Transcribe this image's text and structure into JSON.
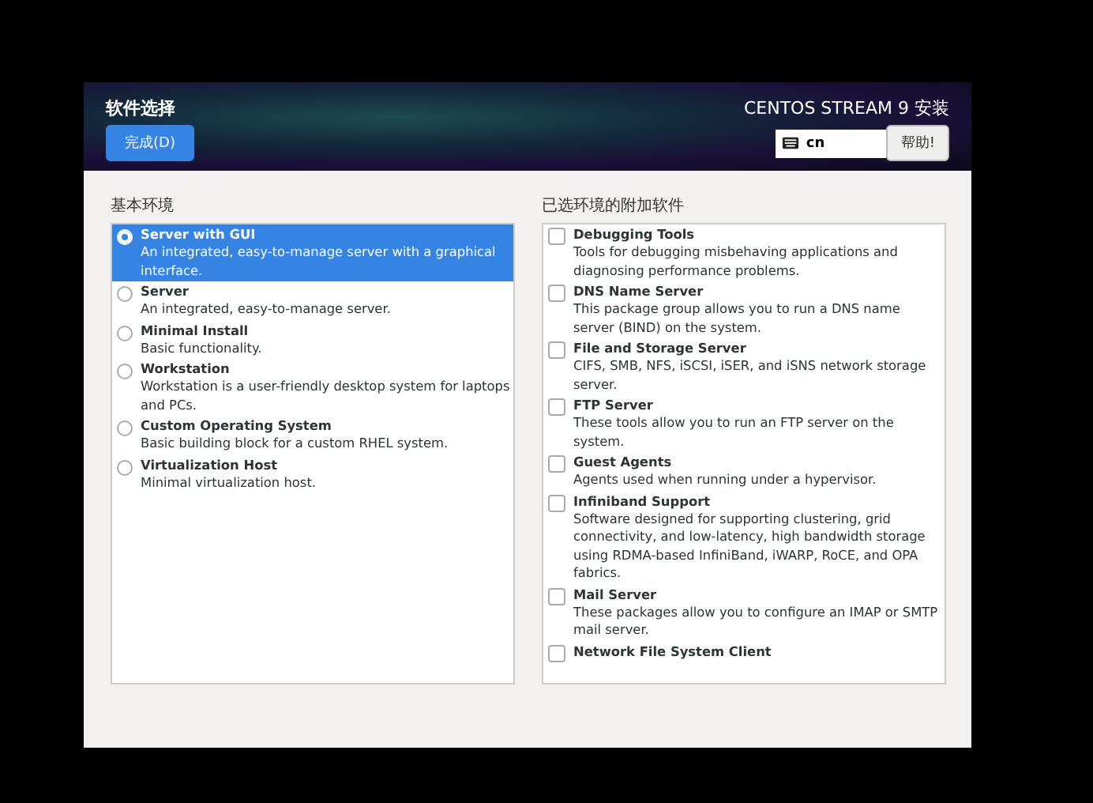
{
  "header": {
    "title": "软件选择",
    "done_button": "完成(D)",
    "product": "CENTOS STREAM 9 安装",
    "keyboard_layout": "cn",
    "help_button": "帮助!"
  },
  "environments": {
    "heading": "基本环境",
    "items": [
      {
        "name": "Server with GUI",
        "description": "An integrated, easy-to-manage server with a graphical interface.",
        "selected": true
      },
      {
        "name": "Server",
        "description": "An integrated, easy-to-manage server.",
        "selected": false
      },
      {
        "name": "Minimal Install",
        "description": "Basic functionality.",
        "selected": false
      },
      {
        "name": "Workstation",
        "description": "Workstation is a user-friendly desktop system for laptops and PCs.",
        "selected": false
      },
      {
        "name": "Custom Operating System",
        "description": "Basic building block for a custom RHEL system.",
        "selected": false
      },
      {
        "name": "Virtualization Host",
        "description": "Minimal virtualization host.",
        "selected": false
      }
    ]
  },
  "addons": {
    "heading": "已选环境的附加软件",
    "items": [
      {
        "name": "Debugging Tools",
        "description": "Tools for debugging misbehaving applications and diagnosing performance problems.",
        "checked": false
      },
      {
        "name": "DNS Name Server",
        "description": "This package group allows you to run a DNS name server (BIND) on the system.",
        "checked": false
      },
      {
        "name": "File and Storage Server",
        "description": "CIFS, SMB, NFS, iSCSI, iSER, and iSNS network storage server.",
        "checked": false
      },
      {
        "name": "FTP Server",
        "description": "These tools allow you to run an FTP server on the system.",
        "checked": false
      },
      {
        "name": "Guest Agents",
        "description": "Agents used when running under a hypervisor.",
        "checked": false
      },
      {
        "name": "Infiniband Support",
        "description": "Software designed for supporting clustering, grid connectivity, and low-latency, high bandwidth storage using RDMA-based InfiniBand, iWARP, RoCE, and OPA fabrics.",
        "checked": false
      },
      {
        "name": "Mail Server",
        "description": "These packages allow you to configure an IMAP or SMTP mail server.",
        "checked": false
      },
      {
        "name": "Network File System Client",
        "checked": false
      }
    ]
  }
}
